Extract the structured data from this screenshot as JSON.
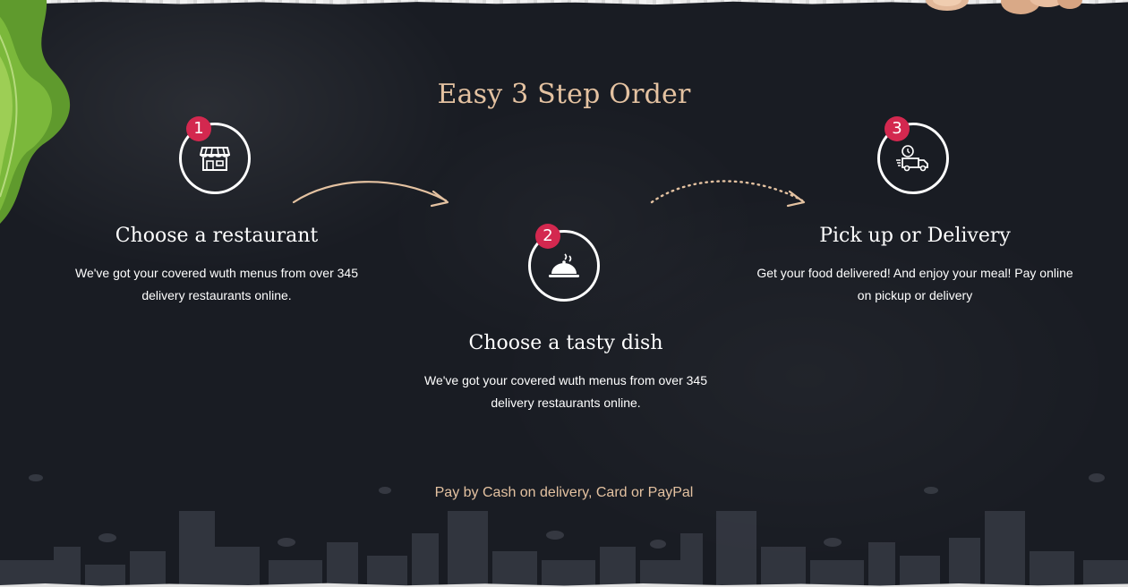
{
  "section": {
    "title": "Easy 3 Step Order",
    "footer_note": "Pay by Cash on delivery, Card or PayPal"
  },
  "steps": [
    {
      "number": "1",
      "title": "Choose a restaurant",
      "description_line1": "We've got your covered wuth menus from over 345",
      "description_line2": "delivery restaurants online.",
      "icon": "store-icon"
    },
    {
      "number": "2",
      "title": "Choose a tasty dish",
      "description_line1": "We've got your covered wuth menus from over 345",
      "description_line2": "delivery restaurants online.",
      "icon": "cloche-icon"
    },
    {
      "number": "3",
      "title": "Pick up or Delivery",
      "description_line1": "Get your food delivered! And enjoy your meal! Pay online",
      "description_line2": "on pickup or delivery",
      "icon": "delivery-truck-icon"
    }
  ],
  "colors": {
    "background": "#191c23",
    "accent_text": "#e4c2a1",
    "badge": "#d3284f",
    "arrow": "#e4c2a1"
  }
}
